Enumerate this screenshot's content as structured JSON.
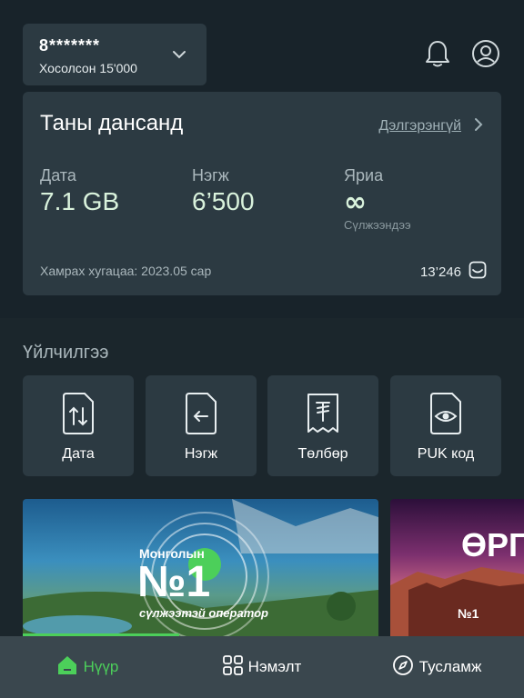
{
  "account": {
    "number": "8*******",
    "plan": "Хосолсон 15'000"
  },
  "balance_card": {
    "title": "Таны дансанд",
    "more_link": "Дэлгэрэнгүй",
    "stats": [
      {
        "label": "Дата",
        "value": "7.1 GB"
      },
      {
        "label": "Нэгж",
        "value": "6’500"
      },
      {
        "label": "Яриа",
        "value": "∞",
        "note": "Сүлжээндээ"
      }
    ],
    "validity": "Хамрах хугацаа: 2023.05 сар",
    "points": "13’246"
  },
  "services": {
    "title": "Үйлчилгээ",
    "items": [
      {
        "label": "Дата",
        "icon": "data-sim-icon"
      },
      {
        "label": "Нэгж",
        "icon": "unit-sim-icon"
      },
      {
        "label": "Төлбөр",
        "icon": "payment-receipt-icon"
      },
      {
        "label": "PUK код",
        "icon": "puk-sim-icon"
      }
    ]
  },
  "banners": [
    {
      "line1": "Монголын",
      "line2": "№1",
      "line3": "сүлжээтэй оператор"
    },
    {
      "line1": "ӨРГ",
      "line2": "№1"
    }
  ],
  "nav": {
    "items": [
      {
        "label": "Нүүр",
        "icon": "home-icon",
        "active": true
      },
      {
        "label": "Нэмэлт",
        "icon": "grid-icon",
        "active": false
      },
      {
        "label": "Тусламж",
        "icon": "compass-icon",
        "active": false
      }
    ]
  },
  "colors": {
    "accent": "#4ccf5a",
    "card": "#2c3a42",
    "background": "#1b262c"
  }
}
